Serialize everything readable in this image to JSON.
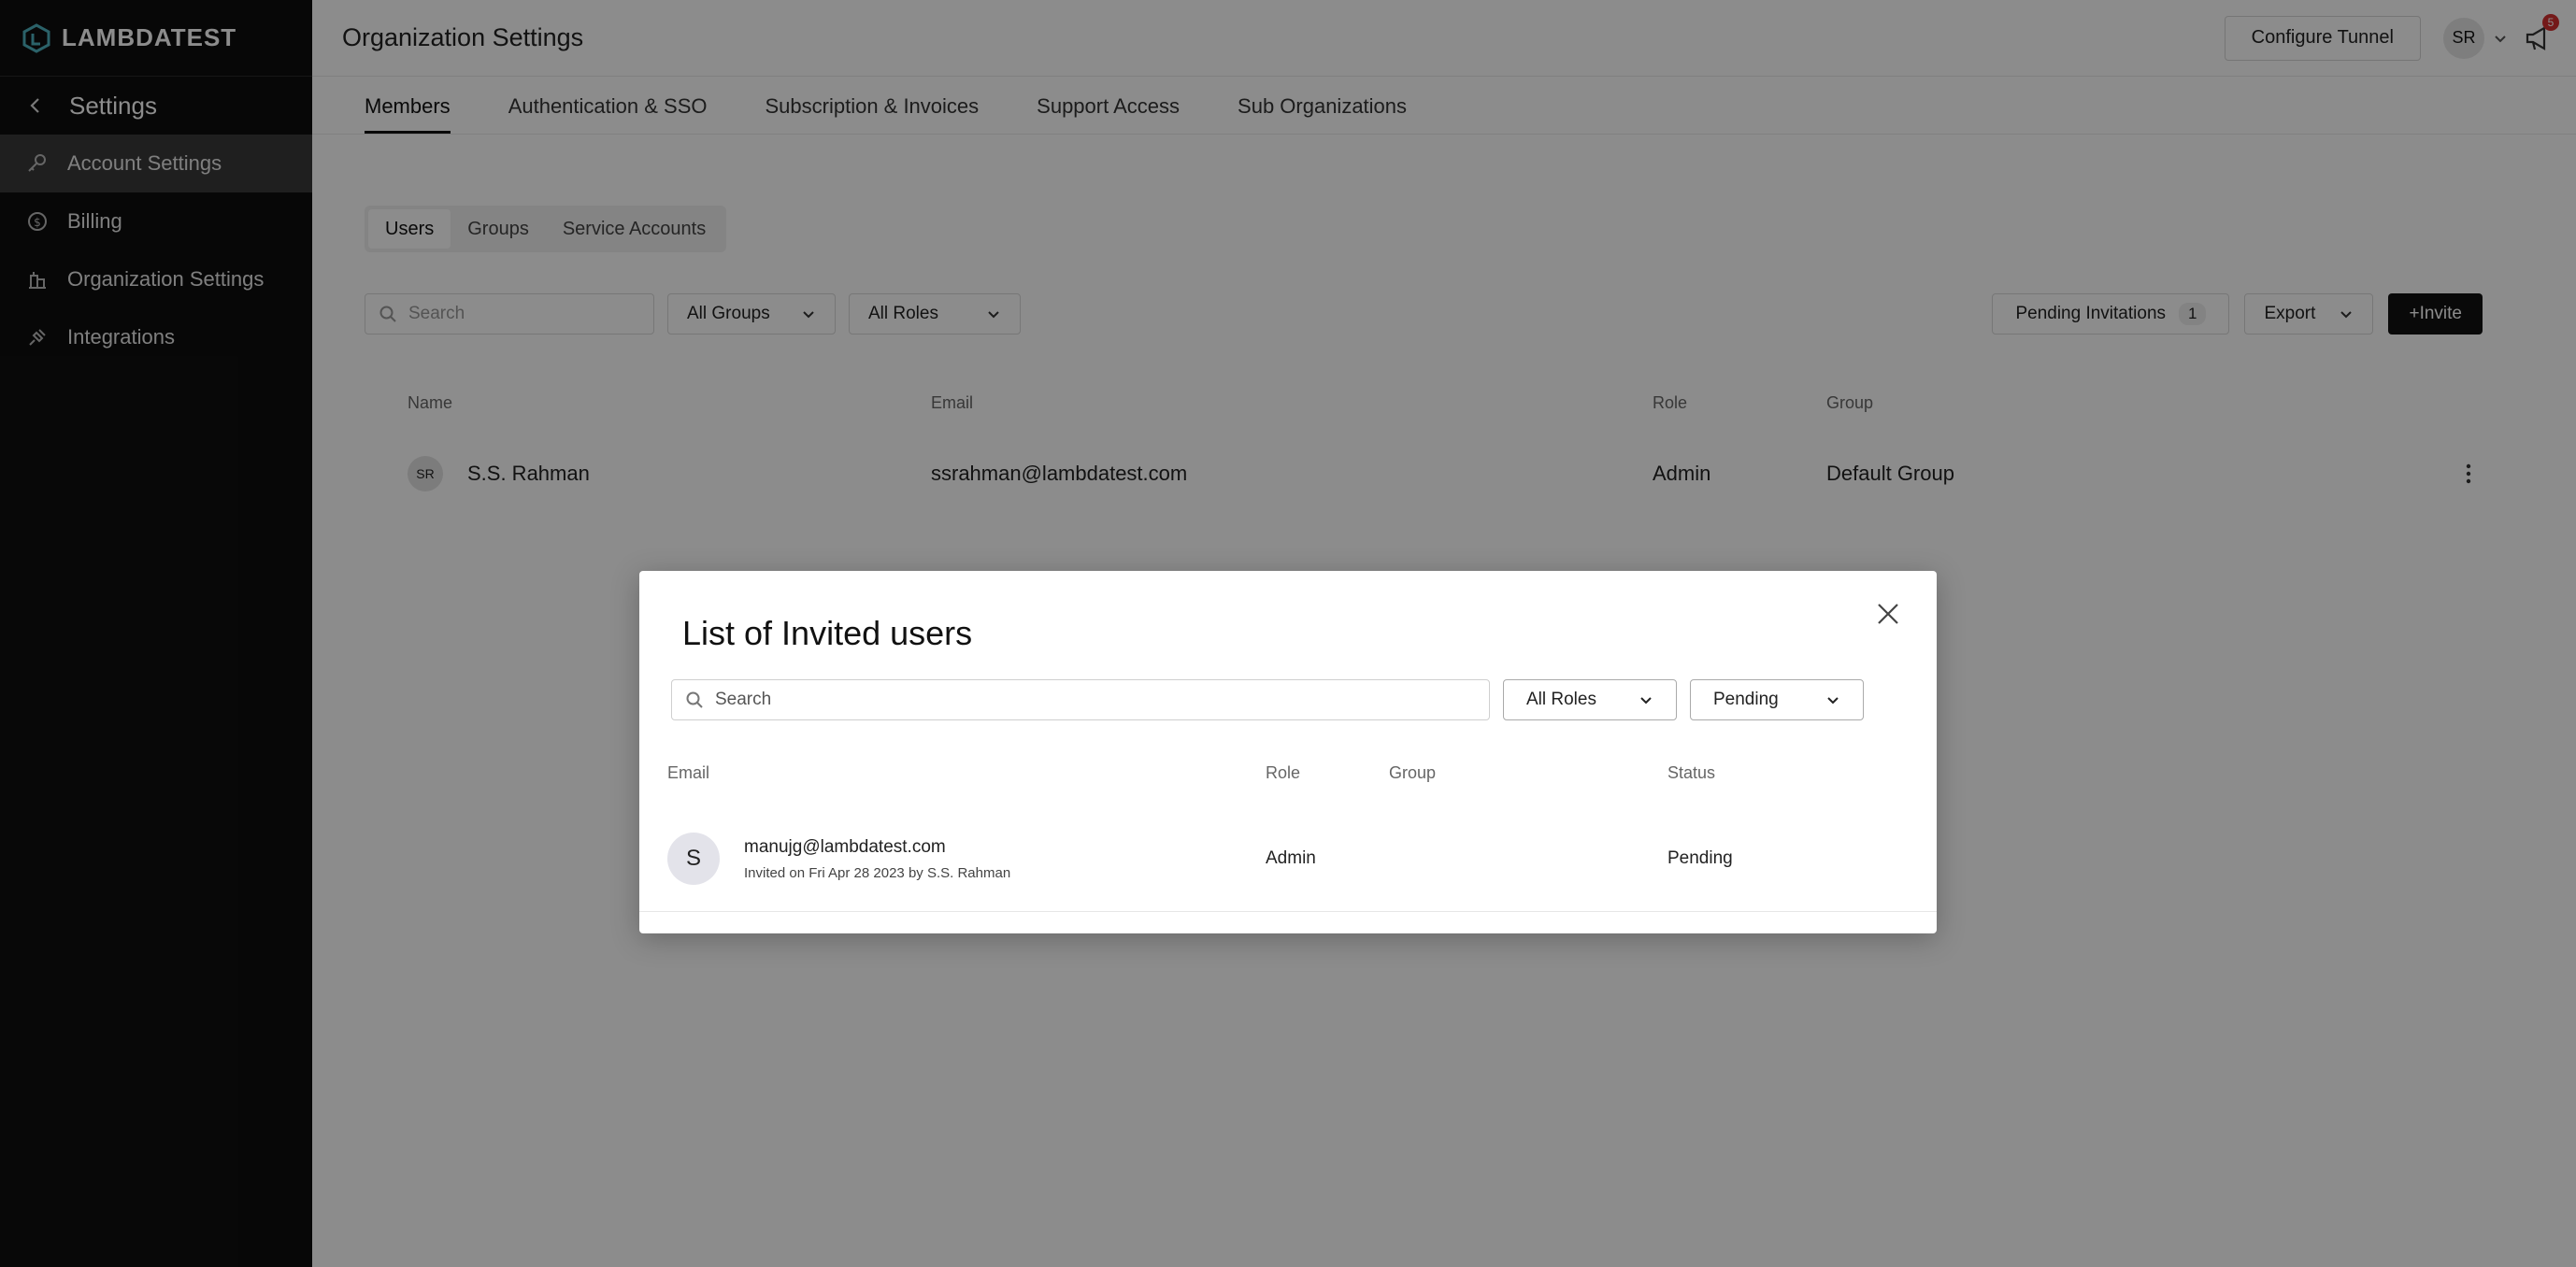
{
  "brand": {
    "name": "LAMBDATEST"
  },
  "sidebar": {
    "back_label": "Settings",
    "items": [
      {
        "label": "Account Settings",
        "icon": "key-icon",
        "active": true
      },
      {
        "label": "Billing",
        "icon": "dollar-icon",
        "active": false
      },
      {
        "label": "Organization Settings",
        "icon": "building-icon",
        "active": false
      },
      {
        "label": "Integrations",
        "icon": "plug-icon",
        "active": false
      }
    ]
  },
  "topbar": {
    "title": "Organization Settings",
    "configure_tunnel": "Configure Tunnel",
    "avatar_initials": "SR",
    "notification_count": "5"
  },
  "tabs": [
    {
      "label": "Members",
      "active": true
    },
    {
      "label": "Authentication & SSO",
      "active": false
    },
    {
      "label": "Subscription & Invoices",
      "active": false
    },
    {
      "label": "Support Access",
      "active": false
    },
    {
      "label": "Sub Organizations",
      "active": false
    }
  ],
  "segments": [
    {
      "label": "Users",
      "active": true
    },
    {
      "label": "Groups",
      "active": false
    },
    {
      "label": "Service Accounts",
      "active": false
    }
  ],
  "filters": {
    "search_placeholder": "Search",
    "groups": "All Groups",
    "roles": "All Roles"
  },
  "actions": {
    "pending_label": "Pending Invitations",
    "pending_count": "1",
    "export": "Export",
    "invite": "+Invite"
  },
  "members_table": {
    "headers": {
      "name": "Name",
      "email": "Email",
      "role": "Role",
      "group": "Group"
    },
    "rows": [
      {
        "initials": "SR",
        "name": "S.S. Rahman",
        "email": "ssrahman@lambdatest.com",
        "role": "Admin",
        "group": "Default Group"
      }
    ]
  },
  "modal": {
    "title": "List of Invited users",
    "search_placeholder": "Search",
    "roles_filter": "All Roles",
    "status_filter": "Pending",
    "headers": {
      "email": "Email",
      "role": "Role",
      "group": "Group",
      "status": "Status"
    },
    "rows": [
      {
        "initial": "S",
        "email": "manujg@lambdatest.com",
        "invited_info": "Invited on Fri Apr 28 2023 by S.S. Rahman",
        "role": "Admin",
        "group": "",
        "status": "Pending"
      }
    ]
  },
  "colors": {
    "sidebar_bg": "#0e0e0e",
    "active_item_bg": "#3a3a3a",
    "accent_dark": "#111111",
    "badge_red": "#d32f2f"
  }
}
